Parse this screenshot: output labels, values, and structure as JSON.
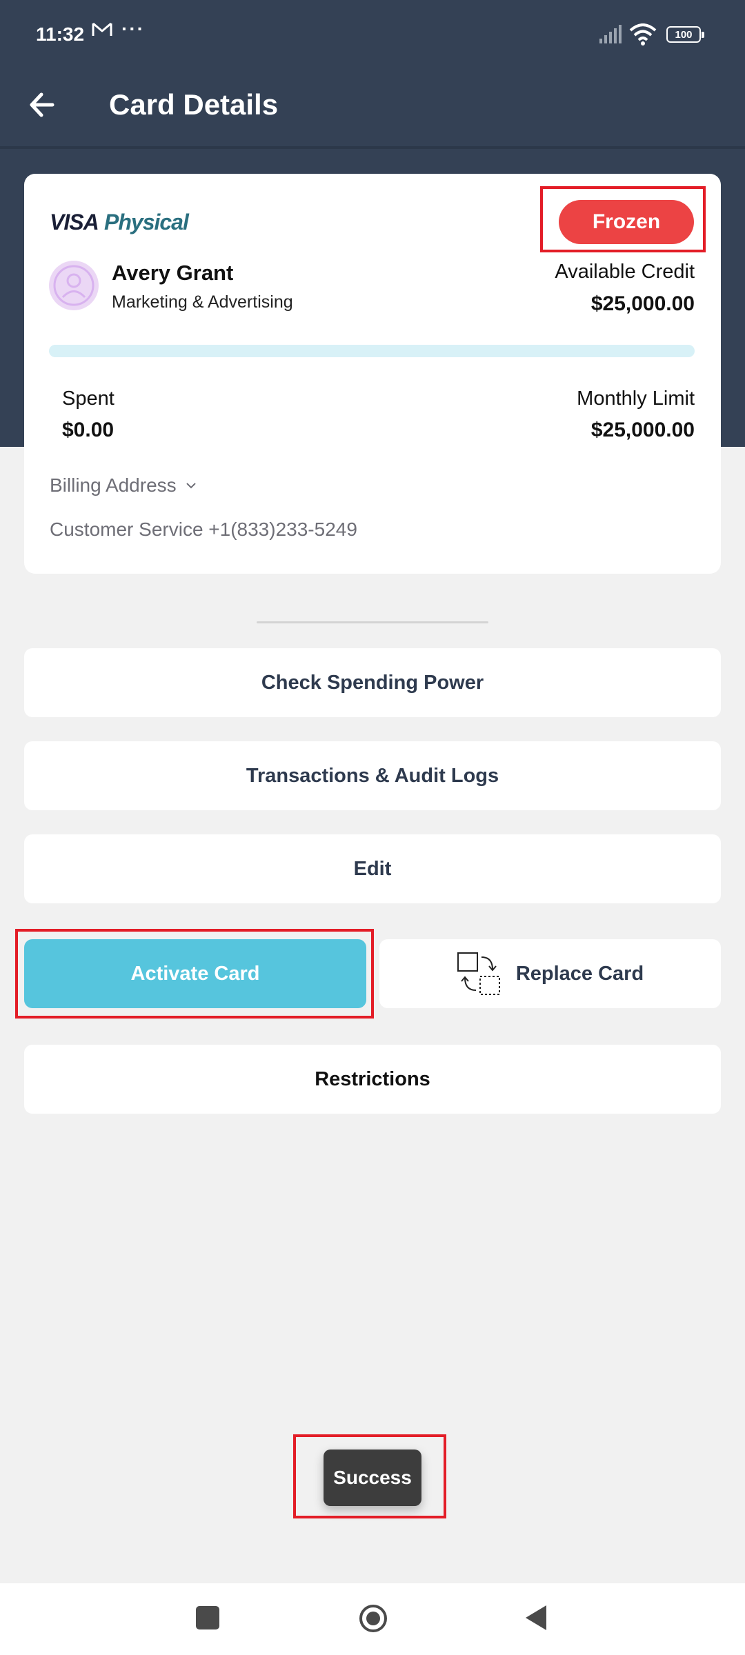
{
  "status_bar": {
    "time": "11:32",
    "dots": "···",
    "battery": "100"
  },
  "header": {
    "title": "Card Details"
  },
  "card": {
    "brand": "VISA",
    "type": "Physical",
    "status": "Frozen",
    "holder_name": "Avery Grant",
    "department": "Marketing & Advertising",
    "available_credit_label": "Available Credit",
    "available_credit": "$25,000.00",
    "spent_fraction": 0.0,
    "spent_label": "Spent",
    "spent": "$0.00",
    "monthly_limit_label": "Monthly Limit",
    "monthly_limit": "$25,000.00",
    "billing_address_label": "Billing Address",
    "customer_service": "Customer Service +1(833)233-5249"
  },
  "actions": {
    "check_spending_power": "Check Spending Power",
    "transactions": "Transactions & Audit Logs",
    "edit": "Edit",
    "activate_card": "Activate Card",
    "replace_card": "Replace Card",
    "restrictions": "Restrictions"
  },
  "toast": {
    "message": "Success"
  },
  "colors": {
    "header_bg": "#344155",
    "accent": "#56c5dd",
    "frozen": "#ec4344",
    "highlight": "#e31d27"
  },
  "icons": {
    "back": "arrow-left-icon",
    "avatar": "user-avatar-icon",
    "replace": "replace-card-icon",
    "chevron": "chevron-down-icon"
  }
}
